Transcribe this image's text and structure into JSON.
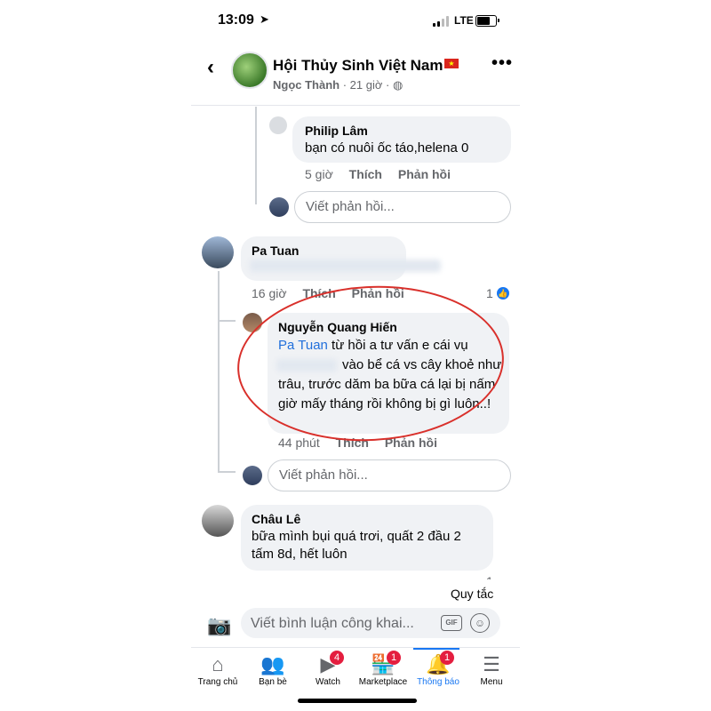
{
  "status_bar": {
    "time": "13:09",
    "network": "LTE"
  },
  "header": {
    "back_icon": "chevron-left-icon",
    "group_name": "Hội Thủy Sinh Việt Nam",
    "author": "Ngọc Thành",
    "time": "21 giờ",
    "privacy_icon": "globe-icon",
    "more_icon": "more-icon"
  },
  "comments": [
    {
      "name": "Philip Lâm",
      "text": "bạn có nuôi ốc táo,helena 0",
      "time": "5 giờ",
      "like": "Thích",
      "reply": "Phản hồi"
    },
    {
      "reply_placeholder": "Viết phản hồi..."
    },
    {
      "name": "Pa Tuan",
      "time": "16 giờ",
      "like": "Thích",
      "reply": "Phản hồi",
      "reactions": "1"
    },
    {
      "name": "Nguyễn Quang Hiến",
      "mention": "Pa Tuan",
      "text1": " từ hồi a tư vấn e cái vụ",
      "text2": "vào bể cá vs cây khoẻ như trâu, trước dăm ba bữa cá lại bị nấm giờ mấy tháng rồi không bị gì luôn..!",
      "time": "44 phút",
      "like": "Thích",
      "reply": "Phản hồi"
    },
    {
      "reply_placeholder": "Viết phản hồi..."
    },
    {
      "name": "Châu Lê",
      "text": "bữa mình bụi quá trơi, quất 2 đầu 2 tấm 8d, hết luôn",
      "reactions": "1"
    }
  ],
  "footer": {
    "rules": "Quy tắc",
    "composer_placeholder": "Viết bình luận công khai...",
    "gif": "GIF"
  },
  "tabs": [
    {
      "label": "Trang chủ",
      "icon": "home-icon"
    },
    {
      "label": "Bạn bè",
      "icon": "friends-icon"
    },
    {
      "label": "Watch",
      "icon": "watch-icon",
      "badge": "4"
    },
    {
      "label": "Marketplace",
      "icon": "marketplace-icon",
      "badge": "1"
    },
    {
      "label": "Thông báo",
      "icon": "bell-icon",
      "badge": "1",
      "active": true
    },
    {
      "label": "Menu",
      "icon": "menu-icon"
    }
  ],
  "colors": {
    "accent": "#1877f2",
    "badge": "#e41e3f",
    "annotation": "#d9302b"
  }
}
